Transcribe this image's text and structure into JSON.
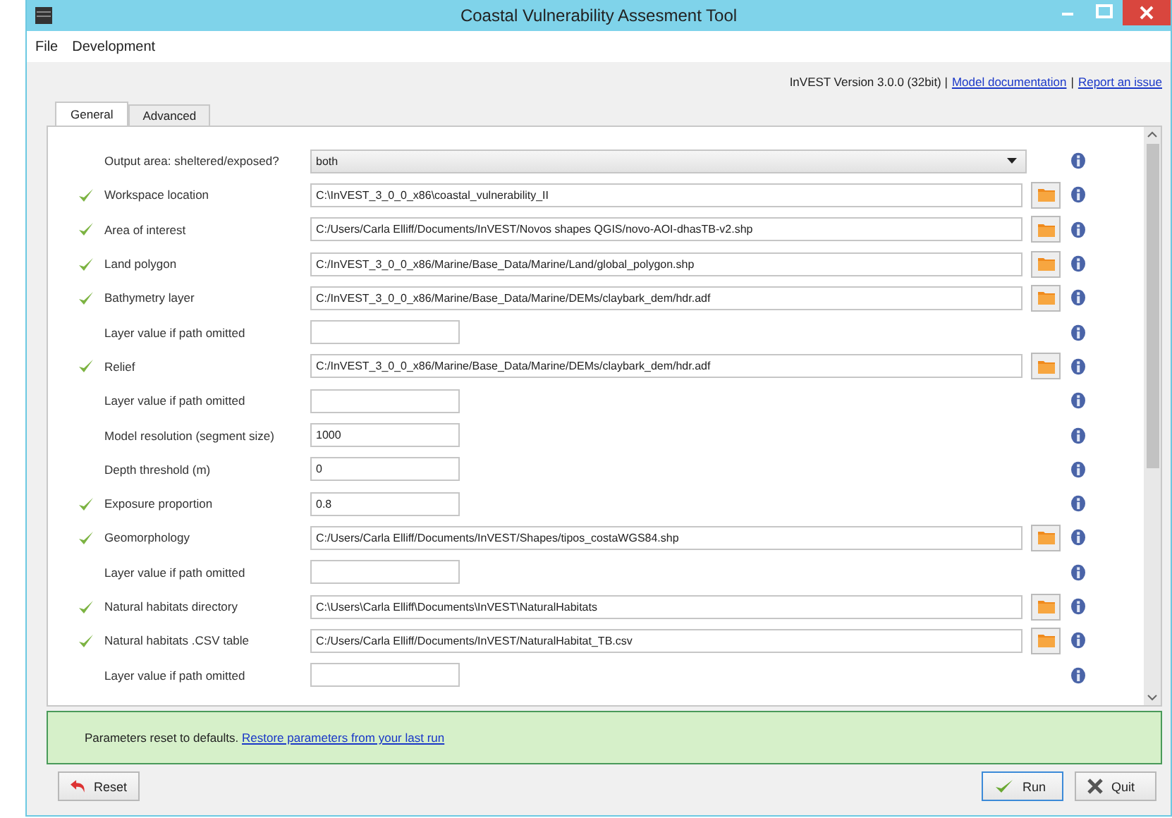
{
  "window": {
    "title": "Coastal Vulnerability Assesment Tool"
  },
  "menu": [
    "File",
    "Development"
  ],
  "header": [
    {
      "kind": "text",
      "text": "InVEST Version 3.0.0 (32bit) |"
    },
    {
      "kind": "link",
      "text": "Model documentation"
    },
    {
      "kind": "text",
      "text": "|"
    },
    {
      "kind": "link",
      "text": "Report an issue"
    }
  ],
  "tabs": [
    {
      "label": "General",
      "selected": true
    },
    {
      "label": "Advanced",
      "selected": false
    }
  ],
  "fields": [
    {
      "kind": "dropdown",
      "label": "Output area: sheltered/exposed?",
      "value": "both",
      "valid": false
    },
    {
      "kind": "path",
      "label": "Workspace location",
      "value": "C:\\InVEST_3_0_0_x86\\coastal_vulnerability_II",
      "valid": true
    },
    {
      "kind": "path",
      "label": "Area of interest",
      "value": "C:/Users/Carla Elliff/Documents/InVEST/Novos shapes QGIS/novo-AOI-dhasTB-v2.shp",
      "valid": true
    },
    {
      "kind": "path",
      "label": "Land polygon",
      "value": "C:/InVEST_3_0_0_x86/Marine/Base_Data/Marine/Land/global_polygon.shp",
      "valid": true
    },
    {
      "kind": "path",
      "label": "Bathymetry layer",
      "value": "C:/InVEST_3_0_0_x86/Marine/Base_Data/Marine/DEMs/claybark_dem/hdr.adf",
      "valid": true
    },
    {
      "kind": "text",
      "label": "Layer value if path omitted",
      "valid": false
    },
    {
      "kind": "path",
      "label": "Relief",
      "value": "C:/InVEST_3_0_0_x86/Marine/Base_Data/Marine/DEMs/claybark_dem/hdr.adf",
      "valid": true
    },
    {
      "kind": "text",
      "label": "Layer value if path omitted",
      "valid": false
    },
    {
      "kind": "text",
      "label": "Model resolution (segment size)",
      "value": "1000",
      "valid": false
    },
    {
      "kind": "text",
      "label": "Depth threshold (m)",
      "value": "0",
      "valid": false
    },
    {
      "kind": "text",
      "label": "Exposure proportion",
      "value": "0.8",
      "valid": true
    },
    {
      "kind": "path",
      "label": "Geomorphology",
      "value": "C:/Users/Carla Elliff/Documents/InVEST/Shapes/tipos_costaWGS84.shp",
      "valid": true
    },
    {
      "kind": "text",
      "label": "Layer value if path omitted",
      "valid": false
    },
    {
      "kind": "path",
      "label": "Natural habitats directory",
      "value": "C:\\Users\\Carla Elliff\\Documents\\InVEST\\NaturalHabitats",
      "valid": true
    },
    {
      "kind": "path",
      "label": "Natural habitats .CSV table",
      "value": "C:/Users/Carla Elliff/Documents/InVEST/NaturalHabitat_TB.csv",
      "valid": true
    },
    {
      "kind": "text",
      "label": "Layer value if path omitted",
      "valid": false
    }
  ],
  "message": {
    "text": "Parameters reset to defaults.",
    "link": "Restore parameters from your last run"
  },
  "buttons": [
    {
      "kind": "reset",
      "label": "Reset"
    },
    {
      "kind": "run",
      "label": "Run"
    },
    {
      "kind": "quit",
      "label": "Quit"
    }
  ]
}
